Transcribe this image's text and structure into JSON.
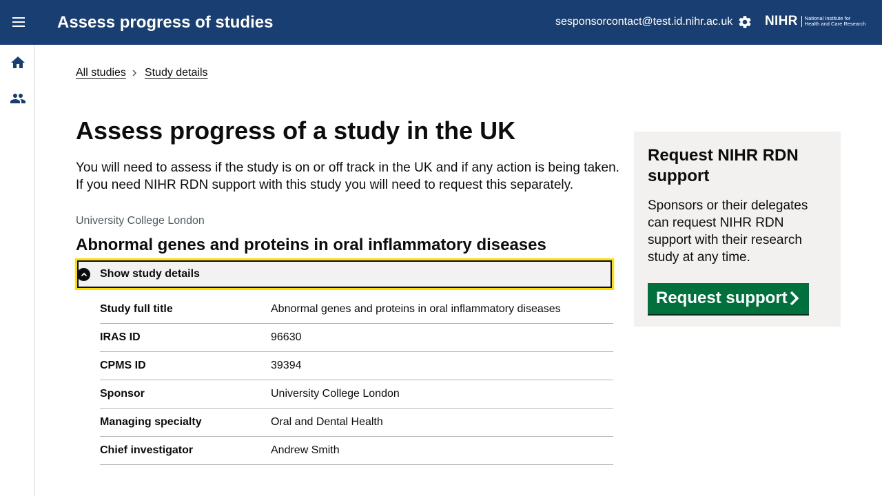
{
  "header": {
    "app_title": "Assess progress of studies",
    "user_email": "sesponsorcontact@test.id.nihr.ac.uk",
    "logo_mark": "NIHR",
    "logo_text_line1": "National Institute for",
    "logo_text_line2": "Health and Care Research"
  },
  "sidenav": {
    "items": [
      {
        "icon": "home-icon"
      },
      {
        "icon": "people-icon"
      }
    ]
  },
  "breadcrumb": {
    "items": [
      "All studies",
      "Study details"
    ]
  },
  "main": {
    "page_title": "Assess progress of a study in the UK",
    "intro": "You will need to assess if the study is on or off track in the UK and if any action is being taken. If you need NIHR RDN support with this study you will need to request this separately.",
    "org_caption": "University College London",
    "study_title": "Abnormal genes and proteins in oral inflammatory diseases",
    "details_toggle_label": "Show study details",
    "study_details": [
      {
        "key": "Study full title",
        "value": "Abnormal genes and proteins in oral inflammatory diseases"
      },
      {
        "key": "IRAS ID",
        "value": "96630"
      },
      {
        "key": "CPMS ID",
        "value": "39394"
      },
      {
        "key": "Sponsor",
        "value": "University College London"
      },
      {
        "key": "Managing specialty",
        "value": "Oral and Dental Health"
      },
      {
        "key": "Chief investigator",
        "value": "Andrew Smith"
      }
    ]
  },
  "side_panel": {
    "heading": "Request NIHR RDN support",
    "text": "Sponsors or their delegates can request NIHR RDN support with their research study at any time.",
    "button_label": "Request support"
  },
  "colors": {
    "header_bg": "#193e72",
    "focus_yellow": "#ffdd00",
    "button_green": "#00703c",
    "panel_bg": "#f2f1ef"
  }
}
